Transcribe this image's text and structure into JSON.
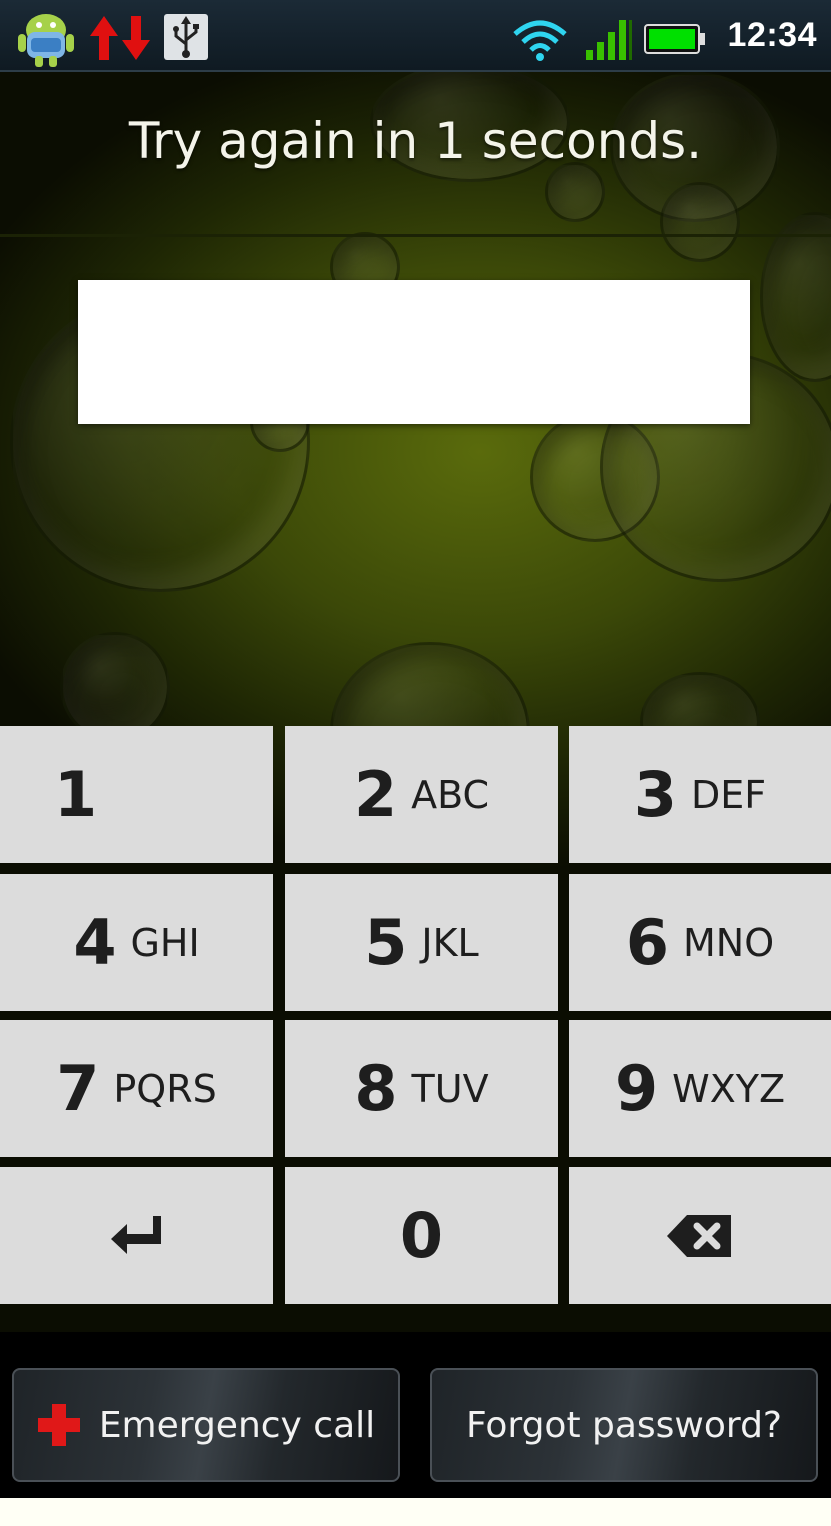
{
  "status_bar": {
    "time": "12:34",
    "icons": [
      "android-icon",
      "data-sync-icon",
      "usb-icon",
      "wifi-icon",
      "signal-icon",
      "battery-icon"
    ],
    "battery_level": 1.0,
    "signal_bars": 4
  },
  "lock_screen": {
    "message": "Try again in 1 seconds.",
    "pin_value": ""
  },
  "keypad": {
    "keys": [
      {
        "num": "1",
        "letters": ""
      },
      {
        "num": "2",
        "letters": "ABC"
      },
      {
        "num": "3",
        "letters": "DEF"
      },
      {
        "num": "4",
        "letters": "GHI"
      },
      {
        "num": "5",
        "letters": "JKL"
      },
      {
        "num": "6",
        "letters": "MNO"
      },
      {
        "num": "7",
        "letters": "PQRS"
      },
      {
        "num": "8",
        "letters": "TUV"
      },
      {
        "num": "9",
        "letters": "WXYZ"
      },
      {
        "num": "0",
        "letters": ""
      }
    ],
    "enter_icon": "enter-icon",
    "delete_icon": "backspace-icon"
  },
  "bottom_buttons": {
    "emergency_label": "Emergency call",
    "emergency_icon": "red-cross-icon",
    "forgot_label": "Forgot password?"
  },
  "colors": {
    "accent_green": "#00e000",
    "signal_green": "#39c000",
    "sync_red": "#e01010",
    "emergency_red": "#e01818",
    "wifi_cyan": "#2fd5f0",
    "key_bg": "#dcdcdc"
  }
}
